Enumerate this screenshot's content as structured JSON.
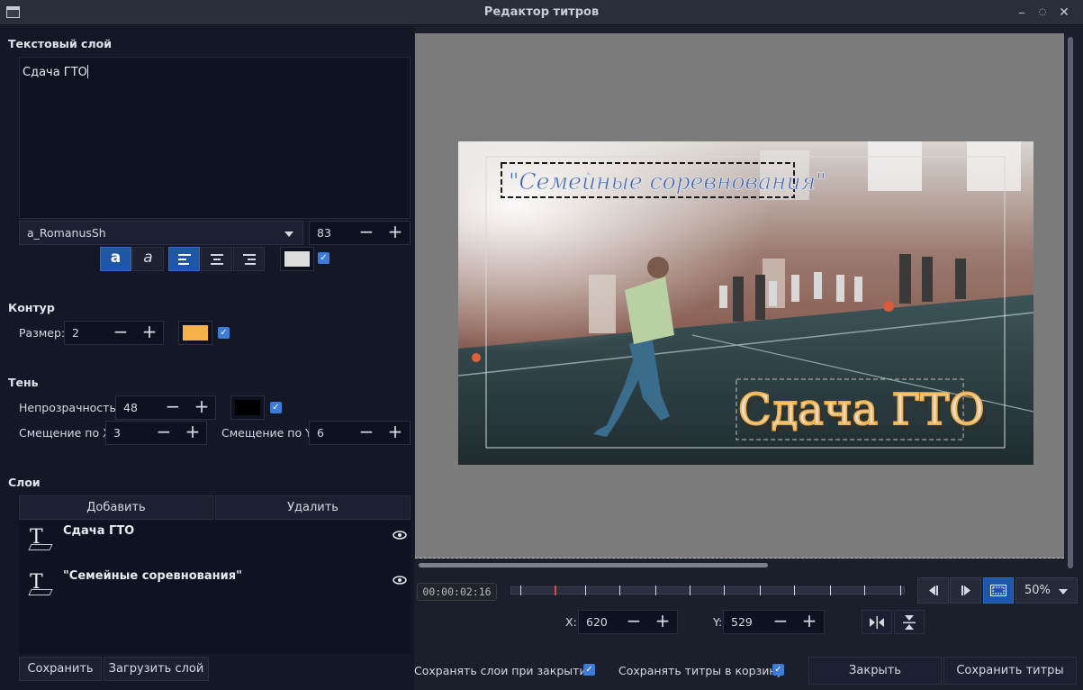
{
  "window": {
    "title": "Редактор титров"
  },
  "text_layer": {
    "section_title": "Текстовый слой",
    "text": "Сдача ГТО",
    "font": "a_RomanusSh",
    "font_size": "83",
    "bold_label": "a",
    "italic_label": "a",
    "text_color": "#dcdcdc",
    "color_enabled": true
  },
  "outline": {
    "section_title": "Контур",
    "size_label": "Размер:",
    "size_value": "2",
    "color": "#f6b24a",
    "enabled": true
  },
  "shadow": {
    "section_title": "Тень",
    "opacity_label": "Непрозрачность:",
    "opacity_value": "48",
    "offset_x_label": "Смещение по X:",
    "offset_x_value": "3",
    "offset_y_label": "Смещение по Y:",
    "offset_y_value": "6",
    "color": "#000000",
    "enabled": true
  },
  "layers": {
    "section_title": "Слои",
    "add_label": "Добавить",
    "delete_label": "Удалить",
    "items": [
      {
        "name": "Сдача ГТО"
      },
      {
        "name": "\"Семейные соревнования\""
      }
    ],
    "save_label": "Сохранить",
    "load_label": "Загрузить слой"
  },
  "preview": {
    "title_text_1": "\"Семейные соревнования\"",
    "title_text_2": "Сдача ГТО"
  },
  "playback": {
    "timecode": "00:00:02:16",
    "zoom": "50%",
    "x_label": "X:",
    "x_value": "620",
    "y_label": "Y:",
    "y_value": "529"
  },
  "footer": {
    "keep_layers_label": "Сохранять слои при закрытии",
    "keep_layers_checked": true,
    "save_to_bin_label": "Сохранять титры в корзину",
    "save_to_bin_checked": true,
    "close_label": "Закрыть",
    "save_titles_label": "Сохранить титры"
  },
  "colors": {
    "accent": "#1e56a8",
    "checkbox": "#3d7bd9",
    "background": "#141726"
  }
}
